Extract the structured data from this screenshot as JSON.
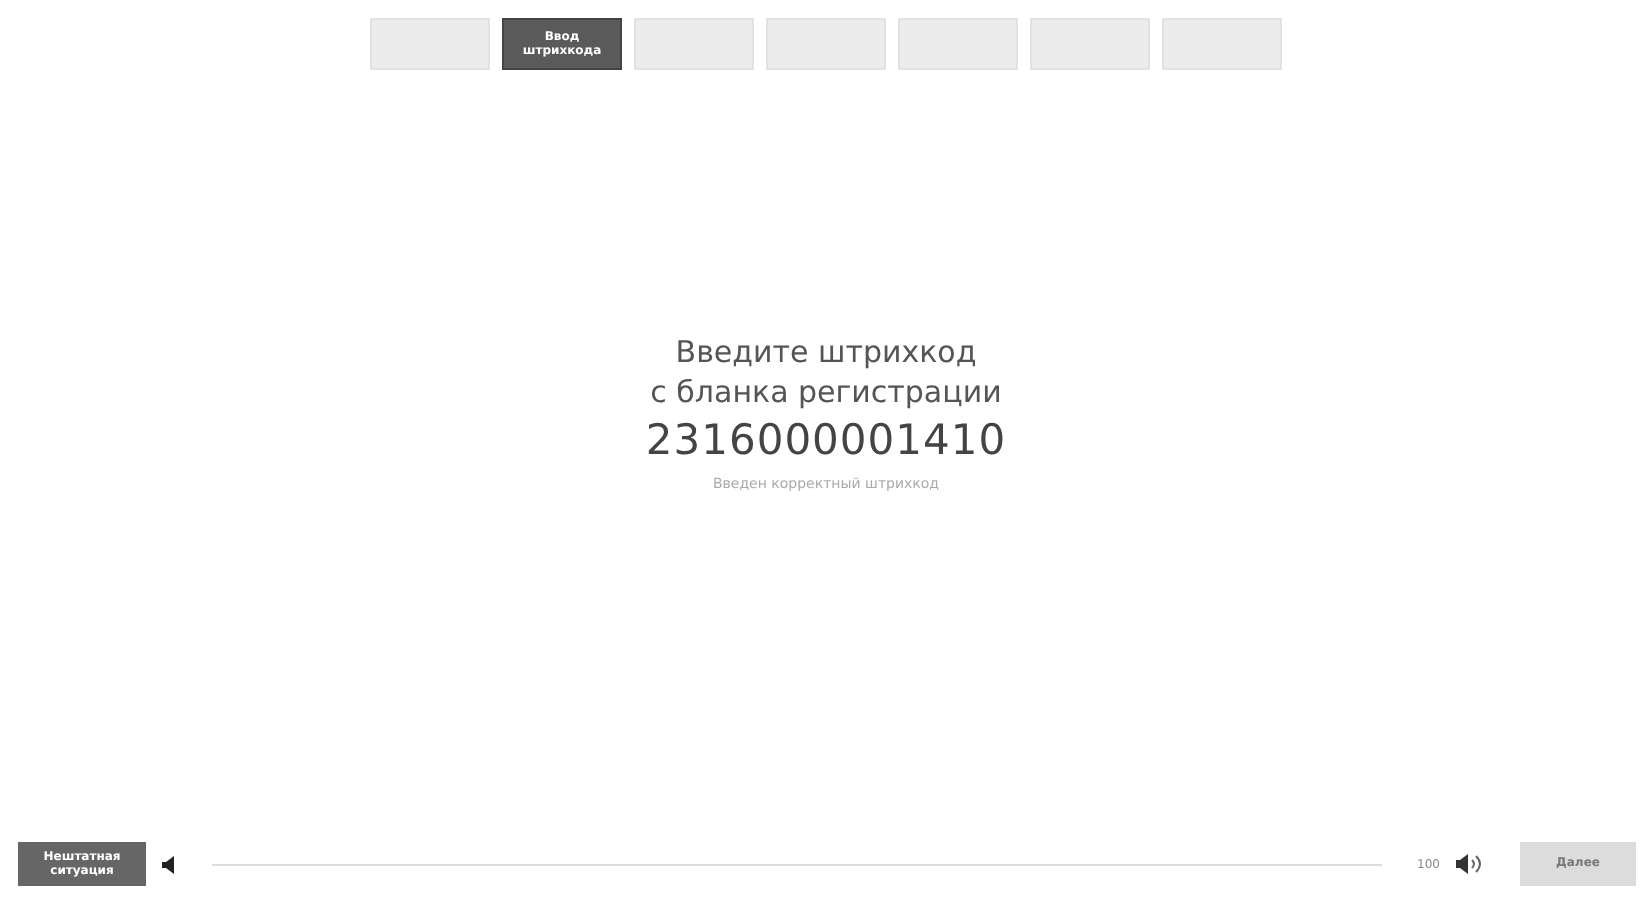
{
  "tabs": [
    {
      "selected": false
    },
    {
      "label": "Ввод штрихкода",
      "selected": true
    },
    {
      "selected": false
    },
    {
      "selected": false
    },
    {
      "selected": false
    },
    {
      "selected": false
    },
    {
      "selected": false
    }
  ],
  "prompt": [
    "Введите штрихкод",
    "с бланка регистрации"
  ],
  "barcode": "2316000001410",
  "status": "Введен корректный штрихкод",
  "footer": {
    "left_button": {
      "label": "Нештатная ситуация",
      "disabled": false
    },
    "volume": "100",
    "next_button": {
      "label": "Далее",
      "disabled": true
    }
  }
}
